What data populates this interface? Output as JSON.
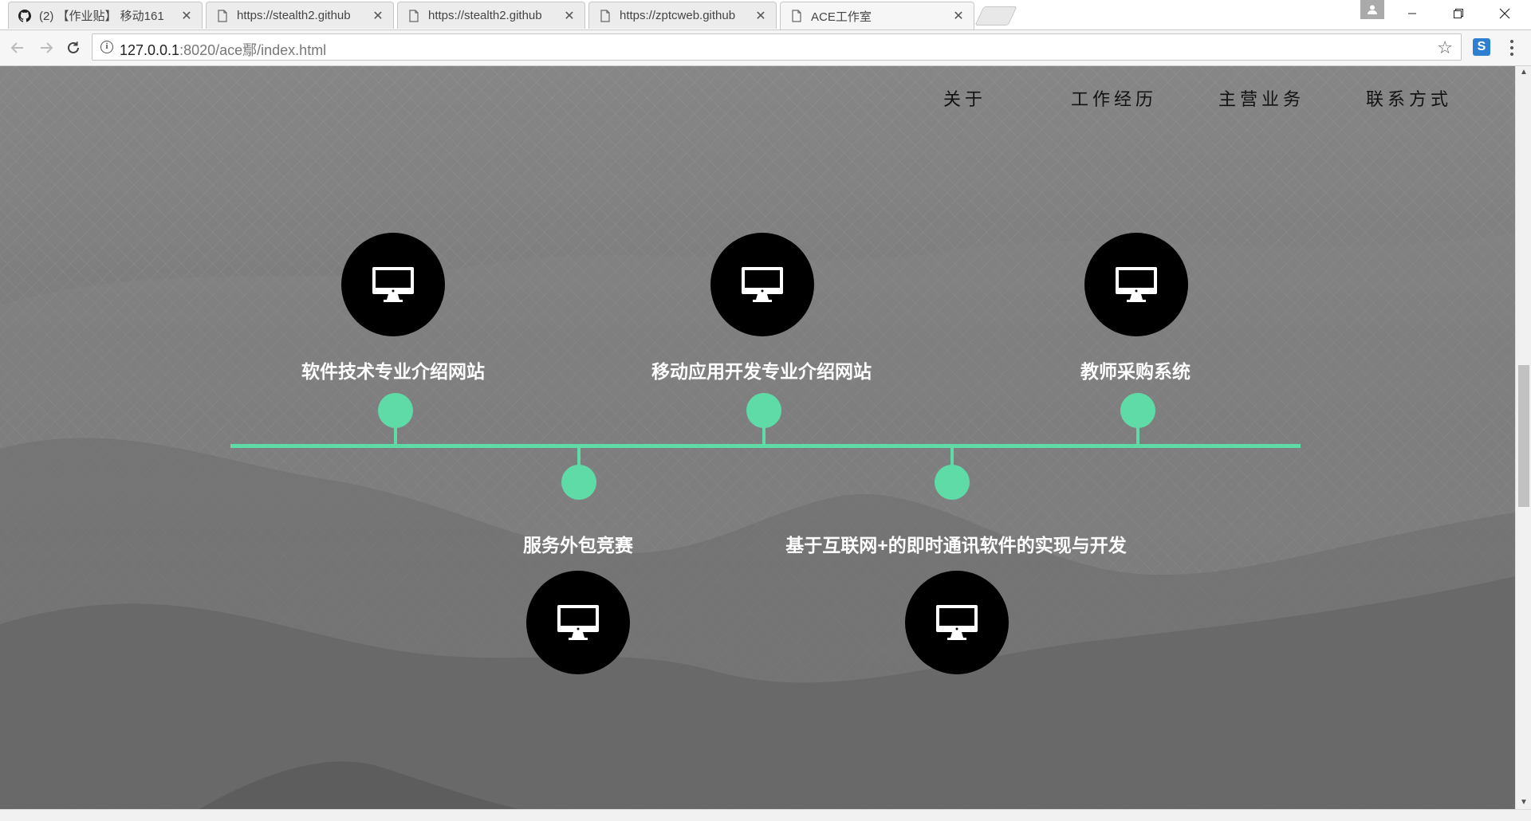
{
  "browser": {
    "tabs": [
      {
        "title": "(2) 【作业贴】 移动161",
        "icon": "github-icon"
      },
      {
        "title": "https://stealth2.github",
        "icon": "page-icon"
      },
      {
        "title": "https://stealth2.github",
        "icon": "page-icon"
      },
      {
        "title": "https://zptcweb.github",
        "icon": "page-icon"
      },
      {
        "title": "ACE工作室",
        "icon": "page-icon",
        "active": true
      }
    ],
    "address": {
      "host": "127.0.0.1",
      "path": ":8020/ace鄢/index.html"
    },
    "extension_label": "S"
  },
  "nav": {
    "items": [
      "关于",
      "工作经历",
      "主营业务",
      "联系方式"
    ]
  },
  "projects": [
    {
      "title": "软件技术专业介绍网站",
      "position": "above"
    },
    {
      "title": "服务外包竞赛",
      "position": "below"
    },
    {
      "title": "移动应用开发专业介绍网站",
      "position": "above"
    },
    {
      "title": "基于互联网+的即时通讯软件的实现与开发",
      "position": "below"
    },
    {
      "title": "教师采购系统",
      "position": "above"
    }
  ],
  "colors": {
    "accent": "#5fdba7",
    "circle": "#000000",
    "label": "#ffffff",
    "nav_text": "#111111"
  }
}
